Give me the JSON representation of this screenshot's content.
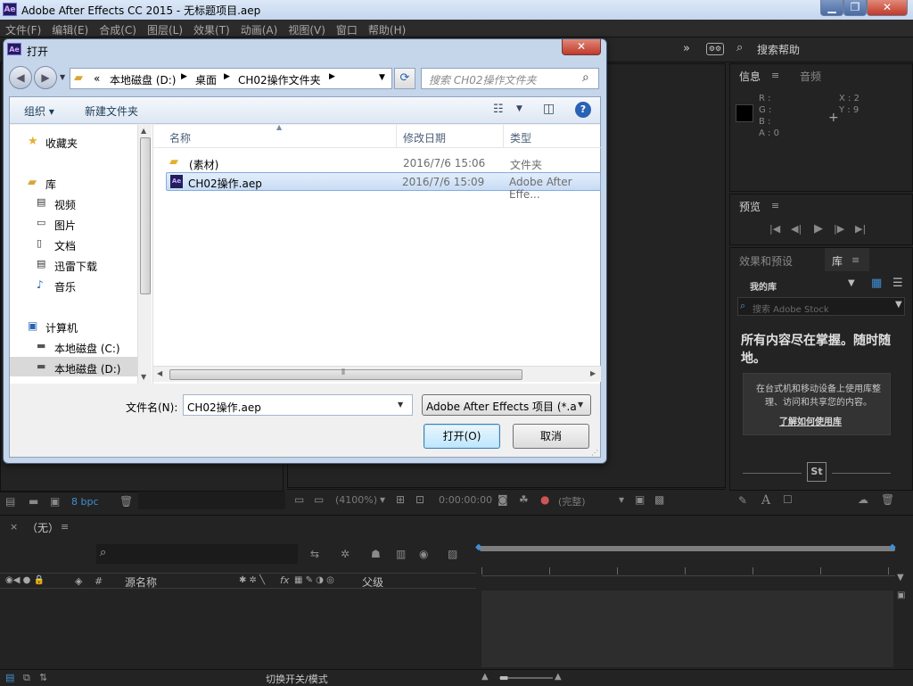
{
  "titlebar": {
    "app_icon": "Ae",
    "title": "Adobe After Effects CC 2015 - 无标题项目.aep"
  },
  "menu": [
    "文件(F)",
    "编辑(E)",
    "合成(C)",
    "图层(L)",
    "效果(T)",
    "动画(A)",
    "视图(V)",
    "窗口",
    "帮助(H)"
  ],
  "toolbar": {
    "search_help": "搜索帮助"
  },
  "info_panel": {
    "tab": "信息",
    "tab2": "音频",
    "r": "R :",
    "g": "G :",
    "b": "B :",
    "a": "A : 0",
    "x": "X : 2",
    "y": "Y : 9"
  },
  "preview_panel": {
    "tab": "预览"
  },
  "library_panel": {
    "tab1": "效果和预设",
    "tab2": "库",
    "my_library": "我的库",
    "search_placeholder": "搜索 Adobe Stock",
    "headline": "所有内容尽在掌握。随时随地。",
    "body": "在台式机和移动设备上使用库整理、访问和共享您的内容。",
    "link": "了解如何使用库",
    "badge": "St"
  },
  "project_footer": {
    "bpc": "8 bpc"
  },
  "viewer_footer": {
    "zoom": "(4100%)",
    "timecode": "0:00:00:00",
    "quality": "(完整)"
  },
  "dialog": {
    "title": "打开",
    "breadcrumb": [
      "«",
      "本地磁盘 (D:)",
      "桌面",
      "CH02操作文件夹"
    ],
    "search_placeholder": "搜索 CH02操作文件夹",
    "organize": "组织 ▾",
    "new_folder": "新建文件夹",
    "nav": {
      "favorites": "收藏夹",
      "libraries": "库",
      "lib_items": [
        "视频",
        "图片",
        "文档",
        "迅雷下载",
        "音乐"
      ],
      "computer": "计算机",
      "drives": [
        "本地磁盘 (C:)",
        "本地磁盘 (D:)"
      ]
    },
    "columns": {
      "name": "名称",
      "date": "修改日期",
      "type": "类型"
    },
    "files": [
      {
        "name": "(素材)",
        "date": "2016/7/6 15:06",
        "type": "文件夹"
      },
      {
        "name": "CH02操作.aep",
        "date": "2016/7/6 15:09",
        "type": "Adobe After Effe..."
      }
    ],
    "filename_label": "文件名(N):",
    "filename_value": "CH02操作.aep",
    "filetype": "Adobe After Effects 项目 (*.a",
    "open_button": "打开(O)",
    "cancel_button": "取消"
  },
  "timeline": {
    "tab": "（无）",
    "search_icon": "⌕",
    "col_source": "源名称",
    "col_parent": "父级",
    "col_hash": "#",
    "fx": "fx",
    "footer_toggle": "切换开关/模式"
  }
}
